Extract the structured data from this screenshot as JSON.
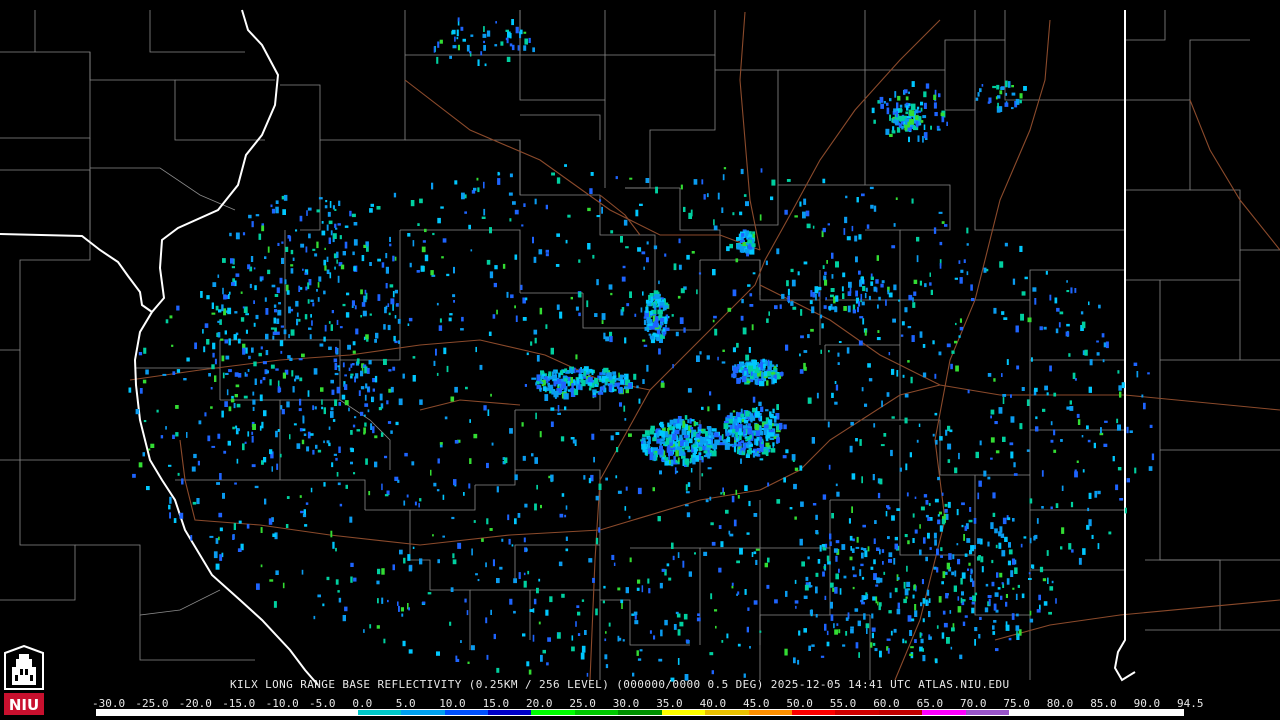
{
  "caption": "KILX LONG RANGE BASE REFLECTIVITY (0.25KM / 256 LEVEL) (000000/0000 0.5 DEG) 2025-12-05 14:41 UTC  ATLAS.NIU.EDU",
  "logo": {
    "text": "NIU",
    "color": "#c8102e"
  },
  "scale": {
    "labels": [
      "-30.0",
      "-25.0",
      "-20.0",
      "-15.0",
      "-10.0",
      "-5.0",
      "0.0",
      "5.0",
      "10.0",
      "15.0",
      "20.0",
      "25.0",
      "30.0",
      "35.0",
      "40.0",
      "45.0",
      "50.0",
      "55.0",
      "60.0",
      "65.0",
      "70.0",
      "75.0",
      "80.0",
      "85.0",
      "90.0",
      "94.5"
    ],
    "colors": [
      "#ffffff",
      "#ffffff",
      "#ffffff",
      "#ffffff",
      "#ffffff",
      "#ffffff",
      "#00c8c8",
      "#00a0f0",
      "#0050ff",
      "#0000c8",
      "#00ff00",
      "#00c800",
      "#009000",
      "#ffff00",
      "#e8c000",
      "#ff9000",
      "#ff0000",
      "#d00000",
      "#c00000",
      "#ff00ff",
      "#9955c9",
      "#ffffff",
      "#ffffff",
      "#ffffff",
      "#ffffff"
    ]
  },
  "map": {
    "background": "#000000",
    "county_line_color": "#8a8a8a",
    "state_line_color": "#ffffff",
    "highway_color": "#8b4a2b",
    "echo_colors": [
      "#00c8ff",
      "#0a9cf0",
      "#1e64ff",
      "#00d0a0",
      "#33dd33"
    ]
  }
}
